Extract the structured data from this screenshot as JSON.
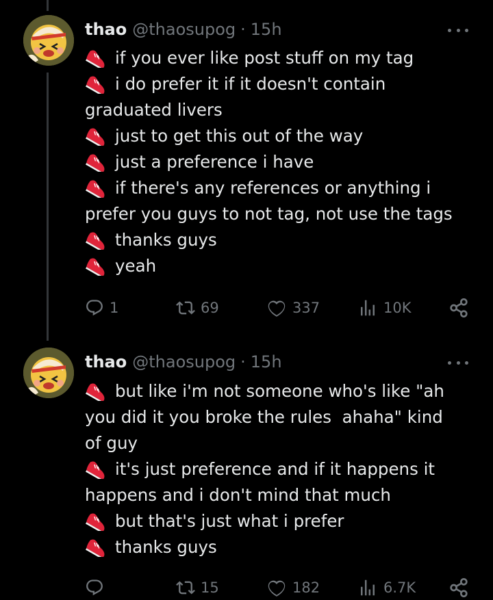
{
  "colors": {
    "background": "#000000",
    "text": "#e7e9ea",
    "muted": "#71767b",
    "thread_line": "#333639",
    "shoe_red": "#e0243a"
  },
  "tweets": [
    {
      "display_name": "thao",
      "handle": "@thaosupog",
      "separator": "·",
      "time": "15h",
      "lines": [
        {
          "emoji": "running-shoe",
          "text": "if you ever like post stuff on my tag"
        },
        {
          "emoji": "running-shoe",
          "text": "i do prefer it if it doesn't contain"
        },
        {
          "text": "graduated livers"
        },
        {
          "emoji": "running-shoe",
          "text": "just to get this out of the way"
        },
        {
          "emoji": "running-shoe",
          "text": "just a preference i have"
        },
        {
          "emoji": "running-shoe",
          "text": "if there's any references or anything i"
        },
        {
          "text": "prefer you guys to not tag, not use the tags"
        },
        {
          "emoji": "running-shoe",
          "text": "thanks guys"
        },
        {
          "emoji": "running-shoe",
          "text": "yeah"
        }
      ],
      "actions": {
        "replies": "1",
        "reposts": "69",
        "likes": "337",
        "views": "10K"
      }
    },
    {
      "display_name": "thao",
      "handle": "@thaosupog",
      "separator": "·",
      "time": "15h",
      "lines": [
        {
          "emoji": "running-shoe",
          "text": "but like i'm not someone who's like \"ah"
        },
        {
          "text": "you did it you broke the rules  ahaha\" kind"
        },
        {
          "text": "of guy"
        },
        {
          "emoji": "running-shoe",
          "text": "it's just preference and if it happens it"
        },
        {
          "text": "happens and i don't mind that much"
        },
        {
          "emoji": "running-shoe",
          "text": "but that's just what i prefer"
        },
        {
          "emoji": "running-shoe",
          "text": "thanks guys"
        }
      ],
      "actions": {
        "replies": "",
        "reposts": "15",
        "likes": "182",
        "views": "6.7K"
      }
    }
  ],
  "icons": {
    "reply": "reply-icon",
    "repost": "repost-icon",
    "like": "heart-icon",
    "views": "views-icon",
    "share": "share-icon",
    "more": "more-icon",
    "emoji": "running-shoe-emoji"
  }
}
